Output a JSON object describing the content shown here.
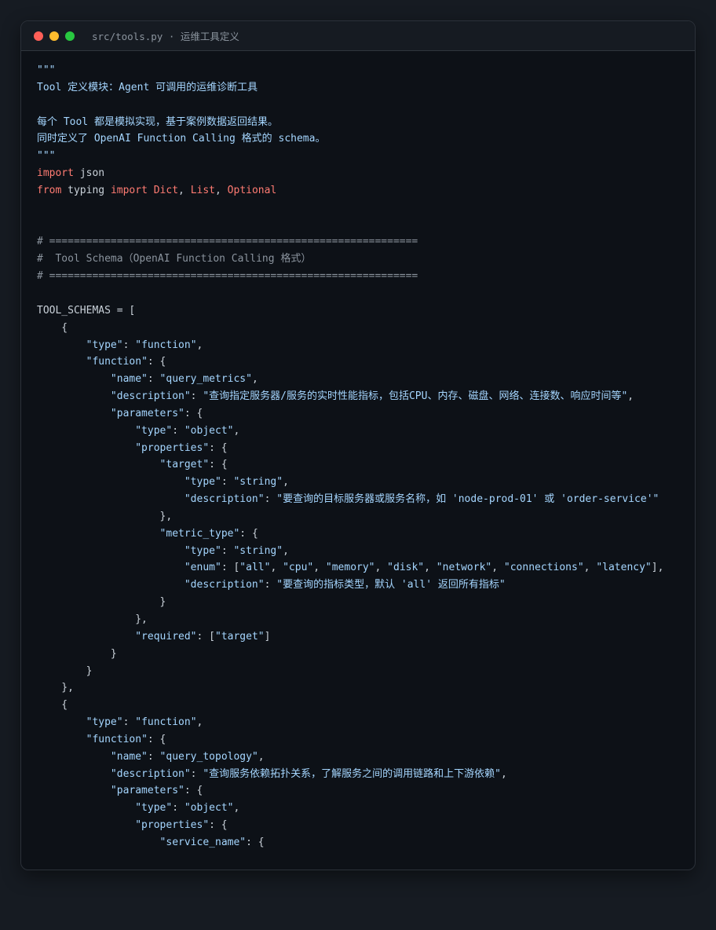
{
  "window": {
    "title": "src/tools.py · 运维工具定义",
    "controls": [
      {
        "name": "close",
        "color": "#ff5f57"
      },
      {
        "name": "minimize",
        "color": "#febc2e"
      },
      {
        "name": "maximize",
        "color": "#28c840"
      }
    ]
  },
  "theme": {
    "background": "#0d1117",
    "keyword": "#ff7b72",
    "string": "#a5d6ff",
    "comment": "#8b949e",
    "text": "#c9d1d9"
  },
  "code": {
    "lines": [
      [
        {
          "t": "\"\"\"",
          "c": "doc"
        }
      ],
      [
        {
          "t": "Tool 定义模块：Agent 可调用的运维诊断工具",
          "c": "doc"
        }
      ],
      [],
      [
        {
          "t": "每个 Tool 都是模拟实现，基于案例数据返回结果。",
          "c": "doc"
        }
      ],
      [
        {
          "t": "同时定义了 OpenAI Function Calling 格式的 schema。",
          "c": "doc"
        }
      ],
      [
        {
          "t": "\"\"\"",
          "c": "doc"
        }
      ],
      [
        {
          "t": "import",
          "c": "kw"
        },
        {
          "t": " json",
          "c": "plain"
        }
      ],
      [
        {
          "t": "from",
          "c": "kw"
        },
        {
          "t": " typing ",
          "c": "plain"
        },
        {
          "t": "import",
          "c": "kw"
        },
        {
          "t": " ",
          "c": "plain"
        },
        {
          "t": "Dict",
          "c": "kw"
        },
        {
          "t": ", ",
          "c": "plain"
        },
        {
          "t": "List",
          "c": "kw"
        },
        {
          "t": ", ",
          "c": "plain"
        },
        {
          "t": "Optional",
          "c": "kw"
        }
      ],
      [],
      [],
      [
        {
          "t": "# ============================================================",
          "c": "com"
        }
      ],
      [
        {
          "t": "#  Tool Schema（OpenAI Function Calling 格式）",
          "c": "com"
        }
      ],
      [
        {
          "t": "# ============================================================",
          "c": "com"
        }
      ],
      [],
      [
        {
          "t": "TOOL_SCHEMAS = [",
          "c": "plain"
        }
      ],
      [
        {
          "t": "    {",
          "c": "plain"
        }
      ],
      [
        {
          "t": "        ",
          "c": "plain"
        },
        {
          "t": "\"type\"",
          "c": "key"
        },
        {
          "t": ": ",
          "c": "plain"
        },
        {
          "t": "\"function\"",
          "c": "str"
        },
        {
          "t": ",",
          "c": "plain"
        }
      ],
      [
        {
          "t": "        ",
          "c": "plain"
        },
        {
          "t": "\"function\"",
          "c": "key"
        },
        {
          "t": ": {",
          "c": "plain"
        }
      ],
      [
        {
          "t": "            ",
          "c": "plain"
        },
        {
          "t": "\"name\"",
          "c": "key"
        },
        {
          "t": ": ",
          "c": "plain"
        },
        {
          "t": "\"query_metrics\"",
          "c": "str"
        },
        {
          "t": ",",
          "c": "plain"
        }
      ],
      [
        {
          "t": "            ",
          "c": "plain"
        },
        {
          "t": "\"description\"",
          "c": "key"
        },
        {
          "t": ": ",
          "c": "plain"
        },
        {
          "t": "\"查询指定服务器/服务的实时性能指标，包括CPU、内存、磁盘、网络、连接数、响应时间等\"",
          "c": "str"
        },
        {
          "t": ",",
          "c": "plain"
        }
      ],
      [
        {
          "t": "            ",
          "c": "plain"
        },
        {
          "t": "\"parameters\"",
          "c": "key"
        },
        {
          "t": ": {",
          "c": "plain"
        }
      ],
      [
        {
          "t": "                ",
          "c": "plain"
        },
        {
          "t": "\"type\"",
          "c": "key"
        },
        {
          "t": ": ",
          "c": "plain"
        },
        {
          "t": "\"object\"",
          "c": "str"
        },
        {
          "t": ",",
          "c": "plain"
        }
      ],
      [
        {
          "t": "                ",
          "c": "plain"
        },
        {
          "t": "\"properties\"",
          "c": "key"
        },
        {
          "t": ": {",
          "c": "plain"
        }
      ],
      [
        {
          "t": "                    ",
          "c": "plain"
        },
        {
          "t": "\"target\"",
          "c": "key"
        },
        {
          "t": ": {",
          "c": "plain"
        }
      ],
      [
        {
          "t": "                        ",
          "c": "plain"
        },
        {
          "t": "\"type\"",
          "c": "key"
        },
        {
          "t": ": ",
          "c": "plain"
        },
        {
          "t": "\"string\"",
          "c": "str"
        },
        {
          "t": ",",
          "c": "plain"
        }
      ],
      [
        {
          "t": "                        ",
          "c": "plain"
        },
        {
          "t": "\"description\"",
          "c": "key"
        },
        {
          "t": ": ",
          "c": "plain"
        },
        {
          "t": "\"要查询的目标服务器或服务名称，如 'node-prod-01' 或 'order-service'\"",
          "c": "str"
        }
      ],
      [
        {
          "t": "                    },",
          "c": "plain"
        }
      ],
      [
        {
          "t": "                    ",
          "c": "plain"
        },
        {
          "t": "\"metric_type\"",
          "c": "key"
        },
        {
          "t": ": {",
          "c": "plain"
        }
      ],
      [
        {
          "t": "                        ",
          "c": "plain"
        },
        {
          "t": "\"type\"",
          "c": "key"
        },
        {
          "t": ": ",
          "c": "plain"
        },
        {
          "t": "\"string\"",
          "c": "str"
        },
        {
          "t": ",",
          "c": "plain"
        }
      ],
      [
        {
          "t": "                        ",
          "c": "plain"
        },
        {
          "t": "\"enum\"",
          "c": "key"
        },
        {
          "t": ": [",
          "c": "plain"
        },
        {
          "t": "\"all\"",
          "c": "str"
        },
        {
          "t": ", ",
          "c": "plain"
        },
        {
          "t": "\"cpu\"",
          "c": "str"
        },
        {
          "t": ", ",
          "c": "plain"
        },
        {
          "t": "\"memory\"",
          "c": "str"
        },
        {
          "t": ", ",
          "c": "plain"
        },
        {
          "t": "\"disk\"",
          "c": "str"
        },
        {
          "t": ", ",
          "c": "plain"
        },
        {
          "t": "\"network\"",
          "c": "str"
        },
        {
          "t": ", ",
          "c": "plain"
        },
        {
          "t": "\"connections\"",
          "c": "str"
        },
        {
          "t": ", ",
          "c": "plain"
        },
        {
          "t": "\"latency\"",
          "c": "str"
        },
        {
          "t": "],",
          "c": "plain"
        }
      ],
      [
        {
          "t": "                        ",
          "c": "plain"
        },
        {
          "t": "\"description\"",
          "c": "key"
        },
        {
          "t": ": ",
          "c": "plain"
        },
        {
          "t": "\"要查询的指标类型，默认 'all' 返回所有指标\"",
          "c": "str"
        }
      ],
      [
        {
          "t": "                    }",
          "c": "plain"
        }
      ],
      [
        {
          "t": "                },",
          "c": "plain"
        }
      ],
      [
        {
          "t": "                ",
          "c": "plain"
        },
        {
          "t": "\"required\"",
          "c": "key"
        },
        {
          "t": ": [",
          "c": "plain"
        },
        {
          "t": "\"target\"",
          "c": "str"
        },
        {
          "t": "]",
          "c": "plain"
        }
      ],
      [
        {
          "t": "            }",
          "c": "plain"
        }
      ],
      [
        {
          "t": "        }",
          "c": "plain"
        }
      ],
      [
        {
          "t": "    },",
          "c": "plain"
        }
      ],
      [
        {
          "t": "    {",
          "c": "plain"
        }
      ],
      [
        {
          "t": "        ",
          "c": "plain"
        },
        {
          "t": "\"type\"",
          "c": "key"
        },
        {
          "t": ": ",
          "c": "plain"
        },
        {
          "t": "\"function\"",
          "c": "str"
        },
        {
          "t": ",",
          "c": "plain"
        }
      ],
      [
        {
          "t": "        ",
          "c": "plain"
        },
        {
          "t": "\"function\"",
          "c": "key"
        },
        {
          "t": ": {",
          "c": "plain"
        }
      ],
      [
        {
          "t": "            ",
          "c": "plain"
        },
        {
          "t": "\"name\"",
          "c": "key"
        },
        {
          "t": ": ",
          "c": "plain"
        },
        {
          "t": "\"query_topology\"",
          "c": "str"
        },
        {
          "t": ",",
          "c": "plain"
        }
      ],
      [
        {
          "t": "            ",
          "c": "plain"
        },
        {
          "t": "\"description\"",
          "c": "key"
        },
        {
          "t": ": ",
          "c": "plain"
        },
        {
          "t": "\"查询服务依赖拓扑关系，了解服务之间的调用链路和上下游依赖\"",
          "c": "str"
        },
        {
          "t": ",",
          "c": "plain"
        }
      ],
      [
        {
          "t": "            ",
          "c": "plain"
        },
        {
          "t": "\"parameters\"",
          "c": "key"
        },
        {
          "t": ": {",
          "c": "plain"
        }
      ],
      [
        {
          "t": "                ",
          "c": "plain"
        },
        {
          "t": "\"type\"",
          "c": "key"
        },
        {
          "t": ": ",
          "c": "plain"
        },
        {
          "t": "\"object\"",
          "c": "str"
        },
        {
          "t": ",",
          "c": "plain"
        }
      ],
      [
        {
          "t": "                ",
          "c": "plain"
        },
        {
          "t": "\"properties\"",
          "c": "key"
        },
        {
          "t": ": {",
          "c": "plain"
        }
      ],
      [
        {
          "t": "                    ",
          "c": "plain"
        },
        {
          "t": "\"service_name\"",
          "c": "key"
        },
        {
          "t": ": {",
          "c": "plain"
        }
      ]
    ]
  }
}
